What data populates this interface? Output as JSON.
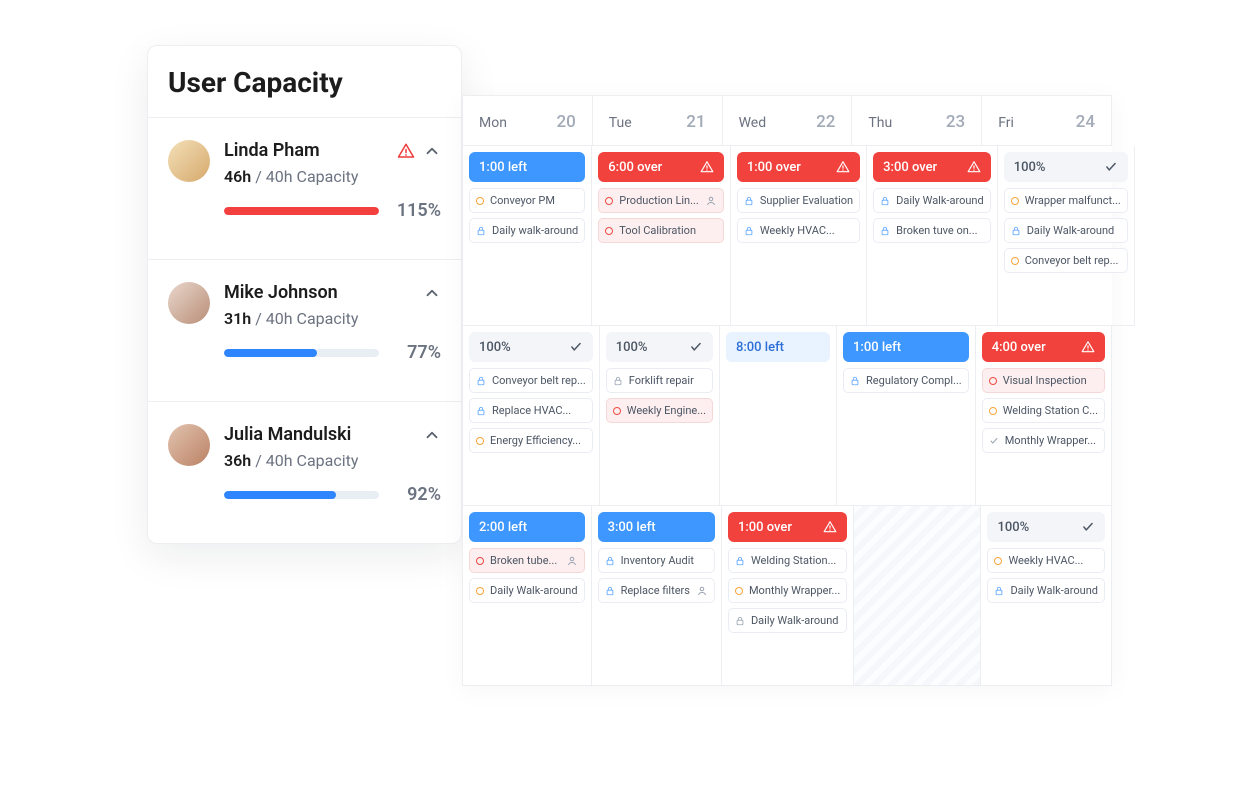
{
  "panel": {
    "title": "User Capacity",
    "capacity_label": "40h Capacity"
  },
  "users": [
    {
      "name": "Linda Pham",
      "alert": true,
      "hours": "46h",
      "pct": "115%",
      "bar": 100,
      "bar_color": "red"
    },
    {
      "name": "Mike Johnson",
      "alert": false,
      "hours": "31h",
      "pct": "77%",
      "bar": 60,
      "bar_color": "blue"
    },
    {
      "name": "Julia Mandulski",
      "alert": false,
      "hours": "36h",
      "pct": "92%",
      "bar": 72,
      "bar_color": "blue"
    }
  ],
  "days": [
    {
      "name": "Mon",
      "num": "20"
    },
    {
      "name": "Tue",
      "num": "21"
    },
    {
      "name": "Wed",
      "num": "22"
    },
    {
      "name": "Thu",
      "num": "23"
    },
    {
      "name": "Fri",
      "num": "24"
    }
  ],
  "rows": [
    [
      {
        "status": {
          "text": "1:00 left",
          "style": "blue-solid"
        },
        "tasks": [
          {
            "icon": "ring-orange",
            "label": "Conveyor PM"
          },
          {
            "icon": "lock-blue",
            "label": "Daily walk-around"
          }
        ]
      },
      {
        "status": {
          "text": "6:00 over",
          "style": "red-solid",
          "trail": "warn"
        },
        "tasks": [
          {
            "icon": "ring-red",
            "label": "Production Lin...",
            "tint": "red",
            "trail": "person"
          },
          {
            "icon": "ring-red",
            "label": "Tool Calibration",
            "tint": "red"
          }
        ]
      },
      {
        "status": {
          "text": "1:00 over",
          "style": "red-solid",
          "trail": "warn"
        },
        "tasks": [
          {
            "icon": "lock-blue",
            "label": "Supplier Evaluation"
          },
          {
            "icon": "lock-blue",
            "label": "Weekly HVAC..."
          }
        ]
      },
      {
        "status": {
          "text": "3:00 over",
          "style": "red-solid",
          "trail": "warn"
        },
        "tasks": [
          {
            "icon": "lock-blue",
            "label": "Daily Walk-around"
          },
          {
            "icon": "lock-blue",
            "label": "Broken tuve on..."
          }
        ]
      },
      {
        "status": {
          "text": "100%",
          "style": "gray",
          "trail": "check"
        },
        "tasks": [
          {
            "icon": "ring-orange",
            "label": "Wrapper malfunct..."
          },
          {
            "icon": "lock-blue",
            "label": "Daily Walk-around"
          },
          {
            "icon": "ring-orange",
            "label": "Conveyor belt rep..."
          }
        ]
      }
    ],
    [
      {
        "status": {
          "text": "100%",
          "style": "gray",
          "trail": "check"
        },
        "tasks": [
          {
            "icon": "lock-blue",
            "label": "Conveyor belt rep..."
          },
          {
            "icon": "lock-blue",
            "label": "Replace HVAC..."
          },
          {
            "icon": "ring-orange",
            "label": "Energy Efficiency..."
          }
        ]
      },
      {
        "status": {
          "text": "100%",
          "style": "gray",
          "trail": "check"
        },
        "tasks": [
          {
            "icon": "lock-gray",
            "label": "Forklift repair"
          },
          {
            "icon": "ring-red",
            "label": "Weekly Engine...",
            "tint": "red"
          }
        ]
      },
      {
        "status": {
          "text": "8:00 left",
          "style": "blue-light"
        },
        "tasks": []
      },
      {
        "status": {
          "text": "1:00 left",
          "style": "blue-solid"
        },
        "tasks": [
          {
            "icon": "lock-blue",
            "label": "Regulatory Compl..."
          }
        ]
      },
      {
        "status": {
          "text": "4:00 over",
          "style": "red-solid",
          "trail": "warn"
        },
        "tasks": [
          {
            "icon": "ring-red",
            "label": "Visual Inspection",
            "tint": "red"
          },
          {
            "icon": "ring-orange",
            "label": "Welding Station C..."
          },
          {
            "icon": "check-gray",
            "label": "Monthly Wrapper..."
          }
        ]
      }
    ],
    [
      {
        "status": {
          "text": "2:00 left",
          "style": "blue-solid"
        },
        "tasks": [
          {
            "icon": "ring-red",
            "label": "Broken tube...",
            "tint": "red",
            "trail": "person"
          },
          {
            "icon": "ring-orange",
            "label": "Daily Walk-around"
          }
        ]
      },
      {
        "status": {
          "text": "3:00 left",
          "style": "blue-solid"
        },
        "tasks": [
          {
            "icon": "lock-blue",
            "label": "Inventory Audit"
          },
          {
            "icon": "lock-blue",
            "label": "Replace filters",
            "trail": "person"
          }
        ]
      },
      {
        "status": {
          "text": "1:00 over",
          "style": "red-solid",
          "trail": "warn"
        },
        "tasks": [
          {
            "icon": "lock-blue",
            "label": "Welding Station..."
          },
          {
            "icon": "ring-orange",
            "label": "Monthly Wrapper..."
          },
          {
            "icon": "lock-gray",
            "label": "Daily Walk-around"
          }
        ]
      },
      {
        "striped": true
      },
      {
        "status": {
          "text": "100%",
          "style": "gray",
          "trail": "check"
        },
        "tasks": [
          {
            "icon": "ring-orange",
            "label": "Weekly HVAC..."
          },
          {
            "icon": "lock-blue",
            "label": "Daily Walk-around"
          }
        ]
      }
    ]
  ]
}
